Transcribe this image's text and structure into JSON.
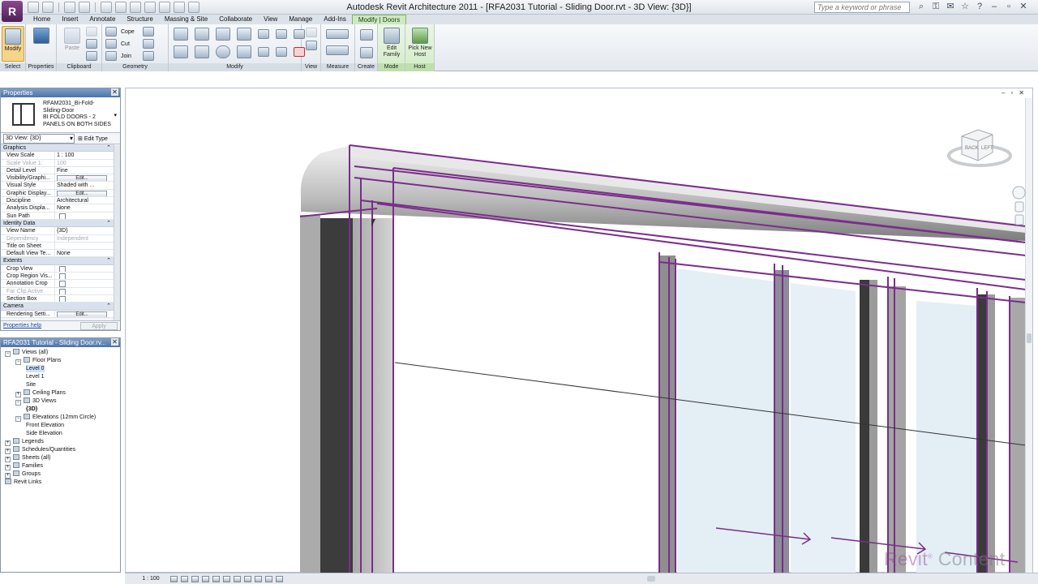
{
  "window": {
    "title": "Autodesk Revit Architecture 2011 - [RFA2031 Tutorial - Sliding Door.rvt - 3D View: {3D}]",
    "search_placeholder": "Type a keyword or phrase",
    "app_button": "R"
  },
  "ribbon": {
    "tabs": [
      "Home",
      "Insert",
      "Annotate",
      "Structure",
      "Massing & Site",
      "Collaborate",
      "View",
      "Manage",
      "Add-Ins",
      "Modify | Doors"
    ],
    "active_tab": "Modify | Doors",
    "panels": {
      "select": {
        "label": "Select",
        "modify": "Modify"
      },
      "properties": {
        "label": "Properties",
        "button": "Properties"
      },
      "clipboard": {
        "label": "Clipboard",
        "paste": "Paste"
      },
      "geometry": {
        "label": "Geometry",
        "cope": "Cope",
        "cut": "Cut",
        "join": "Join"
      },
      "modify": {
        "label": "Modify"
      },
      "view": {
        "label": "View"
      },
      "measure": {
        "label": "Measure"
      },
      "create": {
        "label": "Create"
      },
      "mode": {
        "label": "Mode",
        "edit_family": "Edit Family"
      },
      "host": {
        "label": "Host",
        "pick_new_host": "Pick New Host"
      }
    }
  },
  "properties": {
    "title": "Properties",
    "type_name_lines": [
      "RFAM2031_Bi-Fold-",
      "Sliding-Door",
      "BI FOLD DOORS - 2",
      "PANELS ON BOTH SIDES"
    ],
    "view_selector": "3D View: {3D}",
    "edit_type": "Edit Type",
    "help": "Properties help",
    "apply": "Apply",
    "sections": [
      {
        "name": "Graphics",
        "rows": [
          {
            "name": "View Scale",
            "value": "1 : 100"
          },
          {
            "name": "Scale Value    1:",
            "value": "100",
            "dim": true
          },
          {
            "name": "Detail Level",
            "value": "Fine"
          },
          {
            "name": "Visibility/Graphi...",
            "value": "Edit...",
            "button": true
          },
          {
            "name": "Visual Style",
            "value": "Shaded with ..."
          },
          {
            "name": "Graphic Display...",
            "value": "Edit...",
            "button": true
          },
          {
            "name": "Discipline",
            "value": "Architectural"
          },
          {
            "name": "Analysis Displa...",
            "value": "None"
          },
          {
            "name": "Sun Path",
            "value": "",
            "checkbox": true
          }
        ]
      },
      {
        "name": "Identity Data",
        "rows": [
          {
            "name": "View Name",
            "value": "{3D}"
          },
          {
            "name": "Dependency",
            "value": "Independent",
            "dim": true
          },
          {
            "name": "Title on Sheet",
            "value": ""
          },
          {
            "name": "Default View Te...",
            "value": "None"
          }
        ]
      },
      {
        "name": "Extents",
        "rows": [
          {
            "name": "Crop View",
            "value": "",
            "checkbox": true
          },
          {
            "name": "Crop Region Vis...",
            "value": "",
            "checkbox": true
          },
          {
            "name": "Annotation Crop",
            "value": "",
            "checkbox": true
          },
          {
            "name": "Far Clip Active",
            "value": "",
            "dim": true,
            "checkbox": true
          },
          {
            "name": "Section Box",
            "value": "",
            "checkbox": true
          }
        ]
      },
      {
        "name": "Camera",
        "rows": [
          {
            "name": "Rendering Setti...",
            "value": "Edit...",
            "button": true
          }
        ]
      }
    ]
  },
  "browser": {
    "title": "RFA2031 Tutorial - Sliding Door.rv...",
    "items": [
      {
        "label": "Views (all)",
        "level": 0,
        "toggle": "−"
      },
      {
        "label": "Floor Plans",
        "level": 1,
        "toggle": "−"
      },
      {
        "label": "Level 0",
        "level": 2,
        "selected": true
      },
      {
        "label": "Level 1",
        "level": 2
      },
      {
        "label": "Site",
        "level": 2
      },
      {
        "label": "Ceiling Plans",
        "level": 1,
        "toggle": "+"
      },
      {
        "label": "3D Views",
        "level": 1,
        "toggle": "−"
      },
      {
        "label": "{3D}",
        "level": 2,
        "bold": true
      },
      {
        "label": "Elevations (12mm Circle)",
        "level": 1,
        "toggle": "−"
      },
      {
        "label": "Front Elevation",
        "level": 2
      },
      {
        "label": "Side Elevation",
        "level": 2
      },
      {
        "label": "Legends",
        "level": 0,
        "toggle": "+"
      },
      {
        "label": "Schedules/Quantities",
        "level": 0,
        "toggle": "+"
      },
      {
        "label": "Sheets (all)",
        "level": 0,
        "toggle": "+"
      },
      {
        "label": "Families",
        "level": 0,
        "toggle": "+"
      },
      {
        "label": "Groups",
        "level": 0,
        "toggle": "+"
      },
      {
        "label": "Revit Links",
        "level": 0
      }
    ]
  },
  "viewport": {
    "viewcube_faces": [
      "BACK",
      "LEFT"
    ],
    "scale": "1 : 100",
    "watermark_brand": "Revit",
    "watermark_suffix": "Content",
    "highlight_color": "#7b2d8b"
  }
}
